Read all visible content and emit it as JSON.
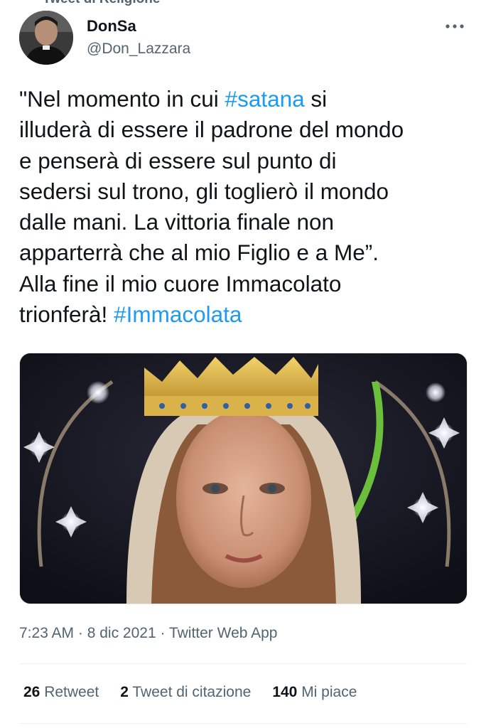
{
  "header": {
    "context_label": "Tweet di Religione",
    "more_icon": "more-horizontal-icon"
  },
  "author": {
    "name": "DonSa",
    "handle": "@Don_Lazzara"
  },
  "tweet": {
    "lines": [
      [
        {
          "t": "\"Nel momento in cui "
        },
        {
          "t": "#satana",
          "h": true
        },
        {
          "t": " si"
        }
      ],
      [
        {
          "t": "illuderà di essere il padrone del mondo"
        }
      ],
      [
        {
          "t": "e penserà di essere sul punto di"
        }
      ],
      [
        {
          "t": "sedersi sul trono, gli toglierò il mondo"
        }
      ],
      [
        {
          "t": "dalle mani. La vittoria finale non"
        }
      ],
      [
        {
          "t": "apparterrà che al mio Figlio e a Me”."
        }
      ],
      [
        {
          "t": "Alla fine il mio cuore Immacolato"
        }
      ],
      [
        {
          "t": "trionferà! "
        },
        {
          "t": "#Immacolata",
          "h": true
        }
      ]
    ],
    "hashtag_color": "#1d9bf0"
  },
  "meta": {
    "time": "7:23 AM",
    "sep1": " · ",
    "date": "8 dic 2021",
    "sep2": " · ",
    "source": "Twitter Web App"
  },
  "stats": {
    "retweets_count": "26",
    "retweets_label": " Retweet",
    "quotes_count": "2",
    "quotes_label": " Tweet di citazione",
    "likes_count": "140",
    "likes_label": " Mi piace"
  }
}
